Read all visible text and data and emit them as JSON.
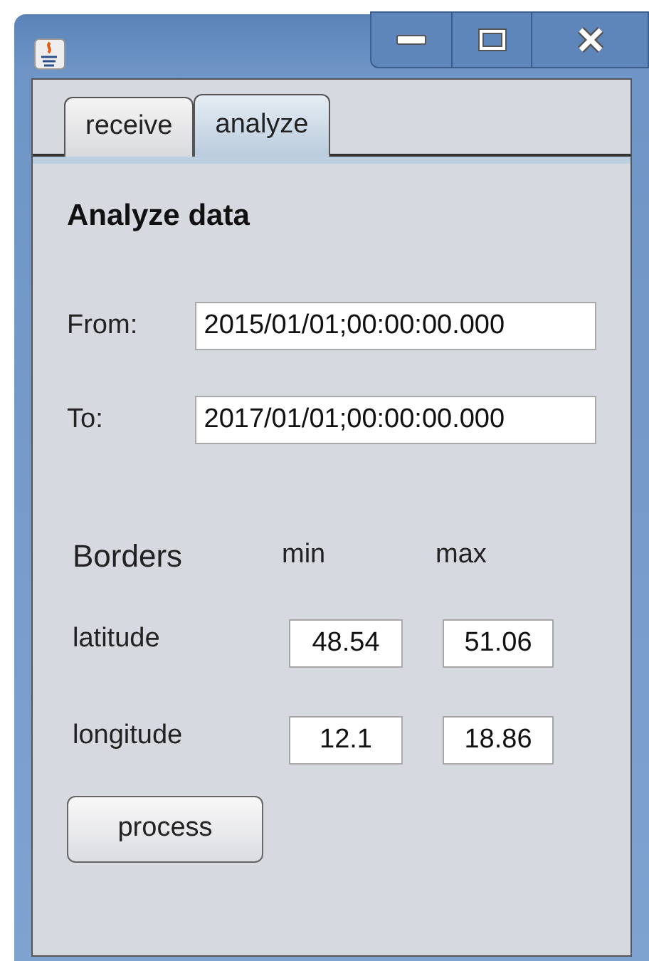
{
  "window": {
    "controls": [
      {
        "kind": "minimize"
      },
      {
        "kind": "maximize"
      },
      {
        "kind": "close"
      }
    ]
  },
  "tabs": [
    {
      "label": "receive",
      "selected": false
    },
    {
      "label": "analyze",
      "selected": true
    }
  ],
  "heading": "Analyze data",
  "range": [
    {
      "label": "From:",
      "value": "2015/01/01;00:00:00.000"
    },
    {
      "label": "To:",
      "value": "2017/01/01;00:00:00.000"
    }
  ],
  "borders": {
    "title": "Borders",
    "columns": [
      "min",
      "max"
    ],
    "rows": [
      {
        "label": "latitude",
        "min": "48.54",
        "max": "51.06"
      },
      {
        "label": "longitude",
        "min": "12.1",
        "max": "18.86"
      }
    ]
  },
  "button": "process"
}
